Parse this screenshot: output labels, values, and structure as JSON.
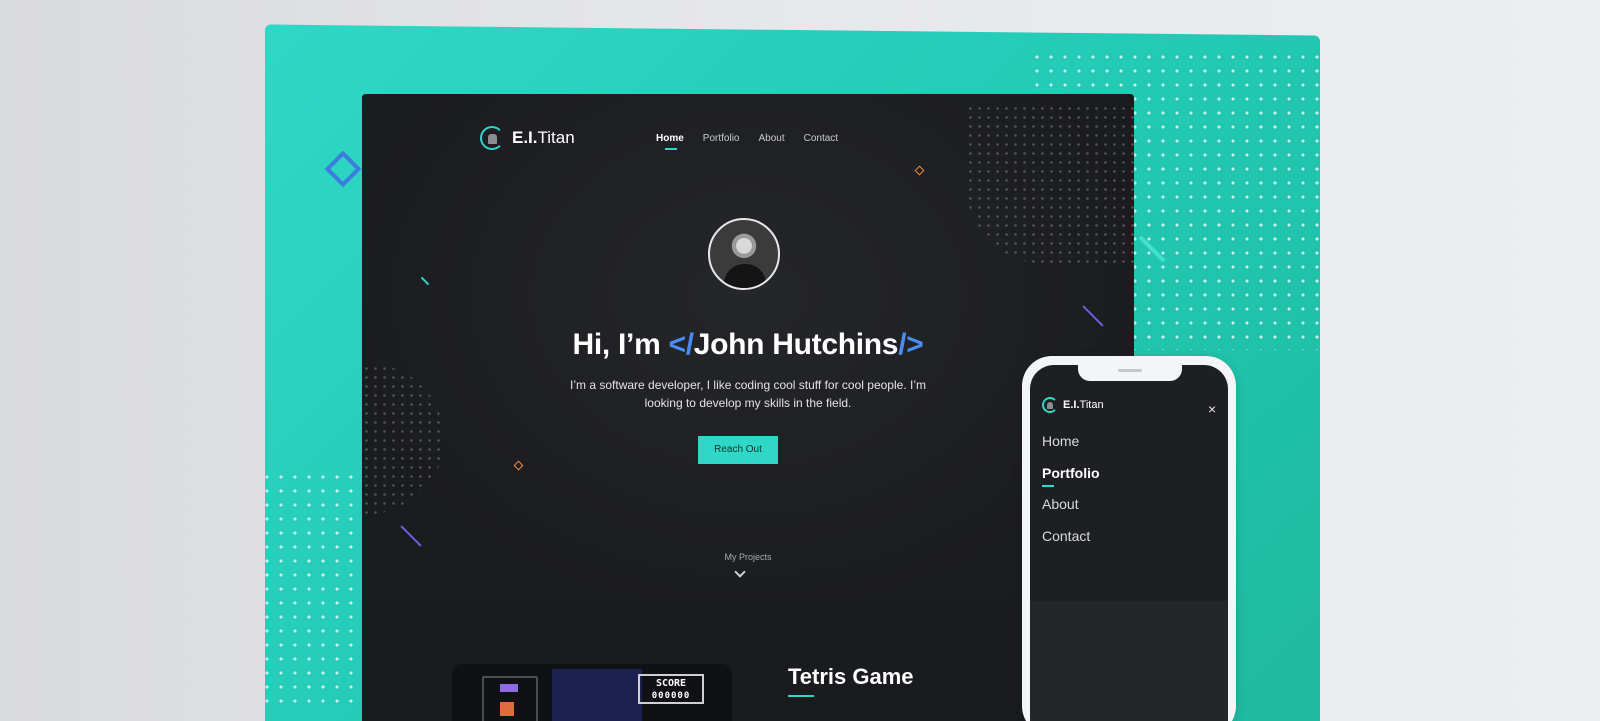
{
  "brand": {
    "logo_bold": "E.I.",
    "logo_rest": "Titan"
  },
  "nav": {
    "items": [
      {
        "label": "Home",
        "active": true
      },
      {
        "label": "Portfolio",
        "active": false
      },
      {
        "label": "About",
        "active": false
      },
      {
        "label": "Contact",
        "active": false
      }
    ]
  },
  "hero": {
    "greeting": "Hi, I’m ",
    "name_prefix": "</",
    "name": "John Hutchins",
    "name_suffix": "/>",
    "description": "I’m a software developer, I like coding cool stuff for cool people. I’m looking to develop my skills in the field.",
    "cta_label": "Reach Out",
    "scroll_label": "My Projects"
  },
  "projects": {
    "first_title": "Tetris Game",
    "score_label": "SCORE",
    "score_value": "000000"
  },
  "mobile": {
    "menu": [
      {
        "label": "Home",
        "active": false
      },
      {
        "label": "Portfolio",
        "active": true
      },
      {
        "label": "About",
        "active": false
      },
      {
        "label": "Contact",
        "active": false
      }
    ],
    "close_icon": "×"
  },
  "colors": {
    "accent_teal": "#2fd8c6",
    "accent_blue": "#4b8cf0",
    "accent_orange": "#f08a3b",
    "dark_bg": "#1e1f22"
  }
}
